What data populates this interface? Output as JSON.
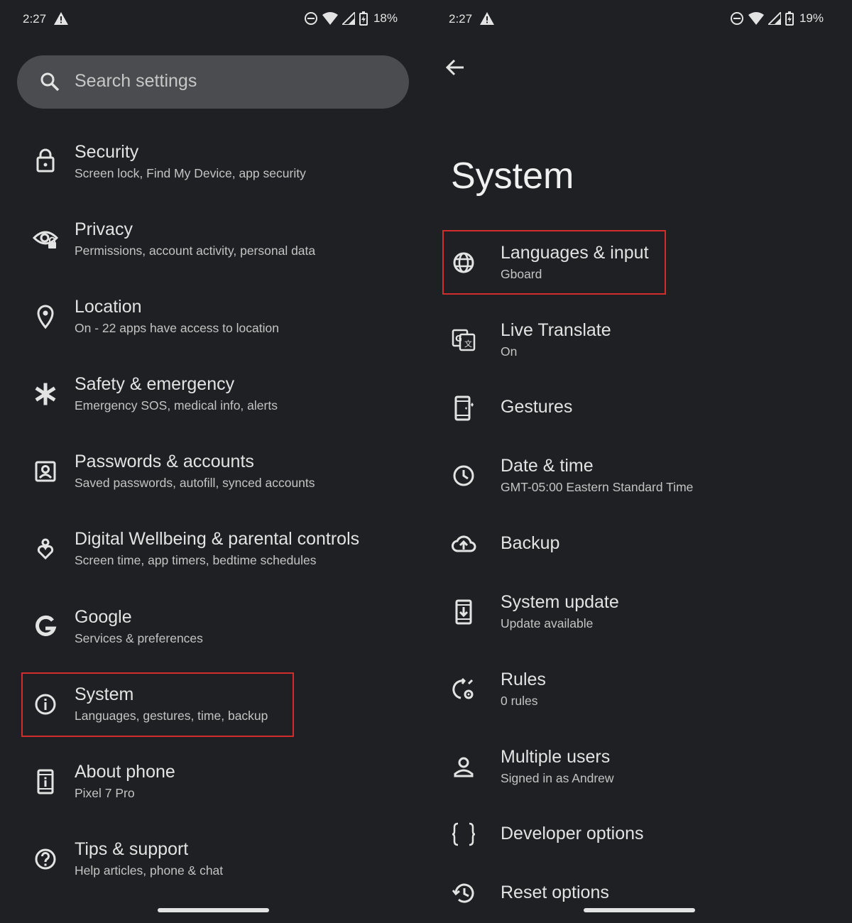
{
  "left": {
    "status": {
      "time": "2:27",
      "battery": "18%"
    },
    "search": {
      "placeholder": "Search settings"
    },
    "items": [
      {
        "title": "Security",
        "subtitle": "Screen lock, Find My Device, app security",
        "icon": "lock-icon"
      },
      {
        "title": "Privacy",
        "subtitle": "Permissions, account activity, personal data",
        "icon": "privacy-eye-icon"
      },
      {
        "title": "Location",
        "subtitle": "On - 22 apps have access to location",
        "icon": "location-pin-icon"
      },
      {
        "title": "Safety & emergency",
        "subtitle": "Emergency SOS, medical info, alerts",
        "icon": "asterisk-icon"
      },
      {
        "title": "Passwords & accounts",
        "subtitle": "Saved passwords, autofill, synced accounts",
        "icon": "account-box-icon"
      },
      {
        "title": "Digital Wellbeing & parental controls",
        "subtitle": "Screen time, app timers, bedtime schedules",
        "icon": "wellbeing-icon"
      },
      {
        "title": "Google",
        "subtitle": "Services & preferences",
        "icon": "google-g-icon"
      },
      {
        "title": "System",
        "subtitle": "Languages, gestures, time, backup",
        "icon": "info-icon",
        "highlighted": true
      },
      {
        "title": "About phone",
        "subtitle": "Pixel 7 Pro",
        "icon": "phone-info-icon"
      },
      {
        "title": "Tips & support",
        "subtitle": "Help articles, phone & chat",
        "icon": "help-icon"
      }
    ]
  },
  "right": {
    "status": {
      "time": "2:27",
      "battery": "19%"
    },
    "title": "System",
    "items": [
      {
        "title": "Languages & input",
        "subtitle": "Gboard",
        "icon": "globe-icon",
        "highlighted": true
      },
      {
        "title": "Live Translate",
        "subtitle": "On",
        "icon": "translate-icon"
      },
      {
        "title": "Gestures",
        "subtitle": "",
        "icon": "gestures-phone-icon"
      },
      {
        "title": "Date & time",
        "subtitle": "GMT-05:00 Eastern Standard Time",
        "icon": "clock-icon"
      },
      {
        "title": "Backup",
        "subtitle": "",
        "icon": "cloud-upload-icon"
      },
      {
        "title": "System update",
        "subtitle": "Update available",
        "icon": "system-update-icon"
      },
      {
        "title": "Rules",
        "subtitle": "0 rules",
        "icon": "rules-icon"
      },
      {
        "title": "Multiple users",
        "subtitle": "Signed in as Andrew",
        "icon": "person-icon"
      },
      {
        "title": "Developer options",
        "subtitle": "",
        "icon": "braces-icon"
      },
      {
        "title": "Reset options",
        "subtitle": "",
        "icon": "history-icon"
      }
    ]
  },
  "colors": {
    "background": "#1f2023",
    "search_bg": "#4b4c4f",
    "highlight": "#d22d2d",
    "text": "#e3e3e3",
    "subtext": "#c4c4c4"
  }
}
